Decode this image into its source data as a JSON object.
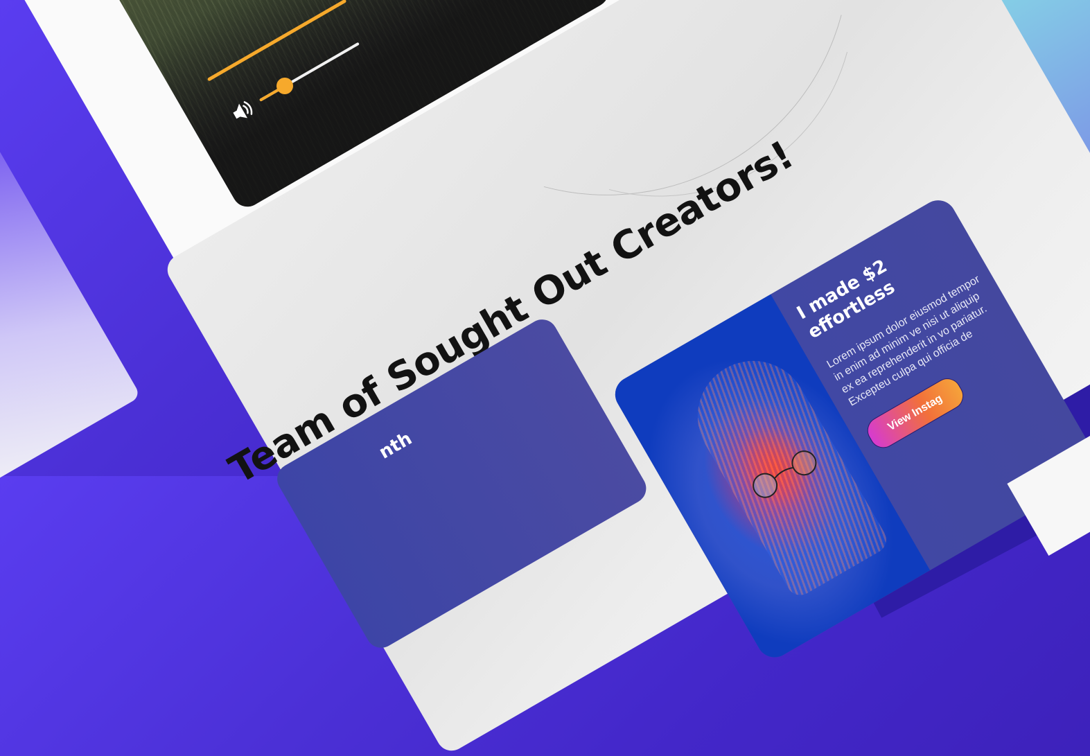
{
  "headline": "Team of Sought Out Creators!",
  "featured_creator": {
    "title": "I made $2 effortless",
    "body": "Lorem ipsum dolor eiusmod tempor in enim ad minim ve nisi ut aliquip ex ea reprehenderit in vo pariatur. Excepteu culpa qui officia de",
    "button_label": "View Instag"
  },
  "second_card": {
    "title": "nth"
  },
  "video_player": {
    "progress_fraction": 0.6,
    "volume_fraction": 0.25
  },
  "colors": {
    "accent": "#f6a92c",
    "background": "#4b30d6",
    "card": "#ececec"
  }
}
